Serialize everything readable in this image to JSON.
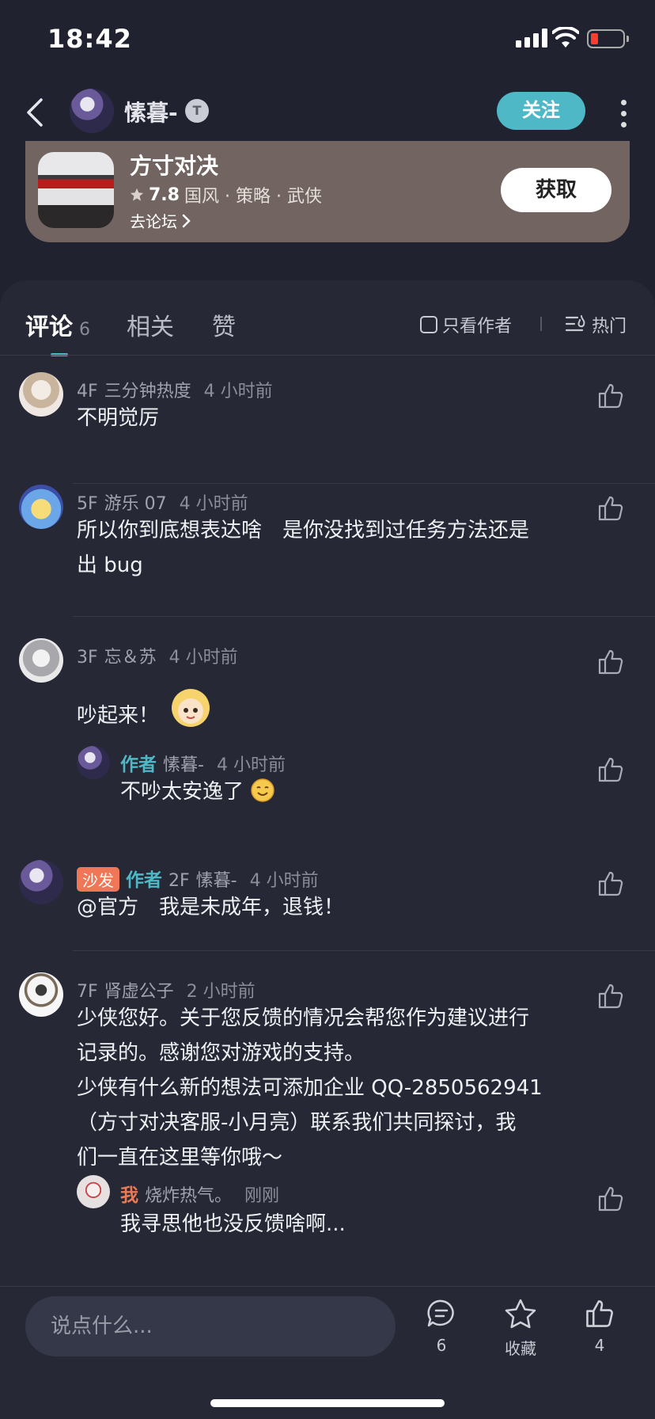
{
  "status_bar": {
    "time": "18:42"
  },
  "header": {
    "username": "愫暮-",
    "badge": "T",
    "follow_label": "关注"
  },
  "game_card": {
    "name": "方寸对决",
    "score": "7.8",
    "tags": "国风 · 策略 · 武侠",
    "forum_link": "去论坛",
    "get_label": "获取"
  },
  "tabs": [
    {
      "label": "评论",
      "count": "6"
    },
    {
      "label": "相关"
    },
    {
      "label": "赞"
    }
  ],
  "filters": {
    "only_author": "只看作者",
    "sort": "热门"
  },
  "comments": [
    {
      "floor": "4F",
      "user": "三分钟热度",
      "time": "4 小时前",
      "text": "不明觉厉"
    },
    {
      "floor": "5F",
      "user": "游乐 07",
      "time": "4 小时前",
      "line1": "所以你到底想表达啥　是你没找到过任务方法还是",
      "line2": "出 bug"
    },
    {
      "floor": "3F",
      "user": "忘＆苏",
      "time": "4 小时前",
      "text": "吵起来！",
      "reply": {
        "tag": "作者",
        "user": "愫暮-",
        "time": "4 小时前",
        "text": "不吵太安逸了"
      }
    },
    {
      "sofa": "沙发",
      "tag": "作者",
      "floor": "2F",
      "user": "愫暮-",
      "time": "4 小时前",
      "text": "@官方　我是未成年，退钱！"
    },
    {
      "floor": "7F",
      "user": "肾虚公子",
      "time": "2 小时前",
      "lines": [
        "少侠您好。关于您反馈的情况会帮您作为建议进行",
        "记录的。感谢您对游戏的支持。",
        "少侠有什么新的想法可添加企业 QQ-2850562941",
        "（方寸对决客服-小月亮）联系我们共同探讨，我",
        "们一直在这里等你哦～"
      ],
      "reply": {
        "tag": "我",
        "user": "烧炸热气。",
        "time": "刚刚",
        "text": "我寻思他也没反馈啥啊..."
      }
    }
  ],
  "bottom_bar": {
    "placeholder": "说点什么...",
    "comment_count": "6",
    "favorite_label": "收藏",
    "like_count": "4"
  },
  "colors": {
    "accent": "#4fb8c6",
    "background": "#202230",
    "panel": "#262835",
    "sofa_badge": "#ef7757",
    "card": "#716461"
  }
}
